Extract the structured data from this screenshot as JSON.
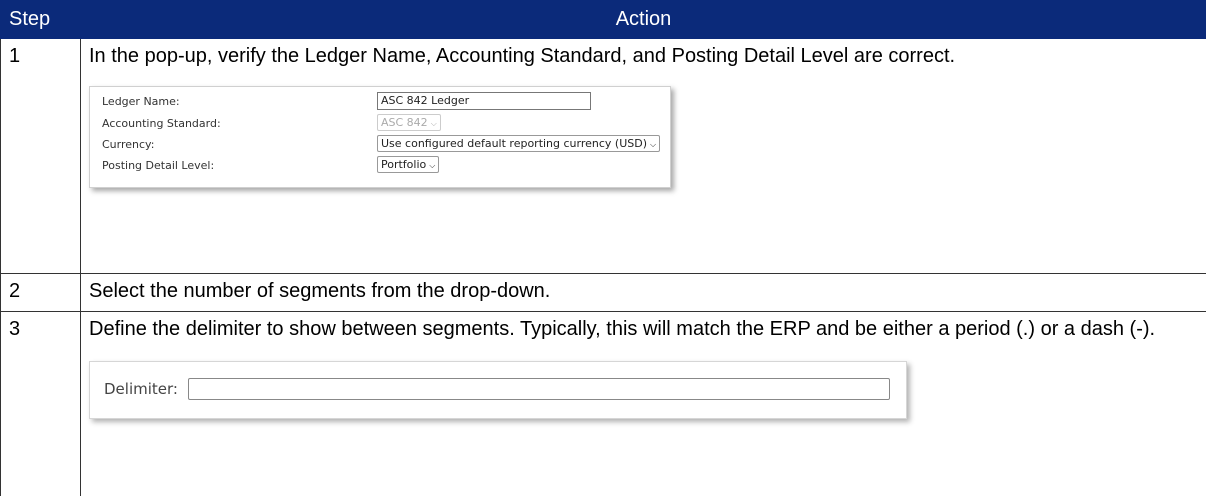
{
  "table": {
    "header": {
      "step": "Step",
      "action": "Action"
    },
    "rows": [
      {
        "step": "1",
        "text": "In the pop-up, verify the Ledger Name, Accounting Standard, and Posting Detail Level are correct."
      },
      {
        "step": "2",
        "text": "Select the number of segments from the drop-down."
      },
      {
        "step": "3",
        "text": "Define the delimiter to show between segments. Typically, this will match the ERP and be either a period (.) or a dash (-)."
      }
    ]
  },
  "ledger_form": {
    "ledger_name_label": "Ledger Name:",
    "ledger_name_value": "ASC 842 Ledger",
    "accounting_standard_label": "Accounting Standard:",
    "accounting_standard_value": "ASC 842",
    "currency_label": "Currency:",
    "currency_value": "Use configured default reporting currency (USD)",
    "posting_detail_label": "Posting Detail Level:",
    "posting_detail_value": "Portfolio"
  },
  "delimiter_form": {
    "label": "Delimiter:",
    "value": ""
  },
  "icons": {
    "dropdown": "chevron-down-icon"
  },
  "colors": {
    "header_bg": "#0b2a7a",
    "header_text": "#ffffff"
  }
}
